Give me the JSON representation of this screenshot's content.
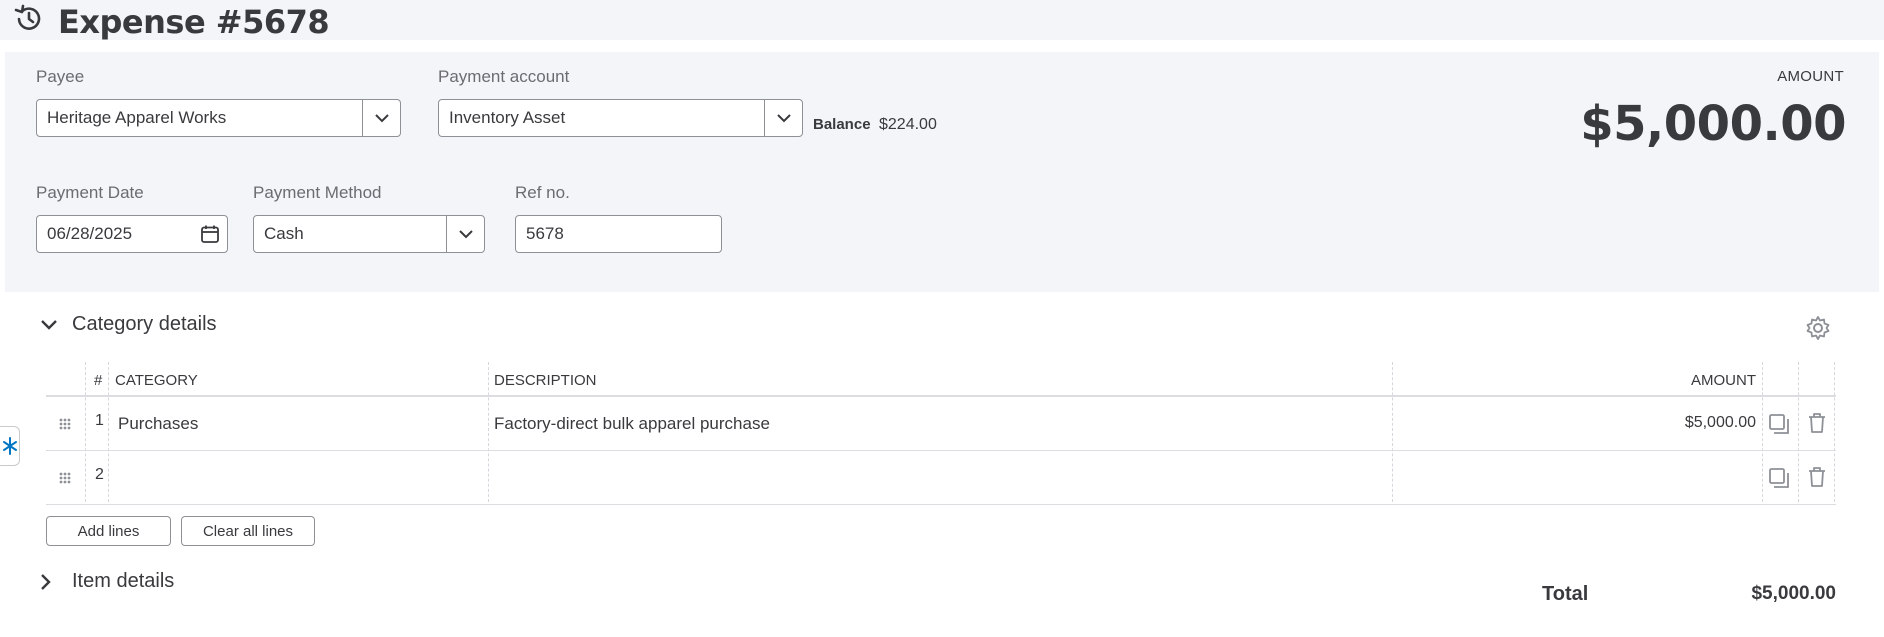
{
  "header": {
    "title": "Expense #5678",
    "history_icon": "history-icon"
  },
  "form": {
    "payee": {
      "label": "Payee",
      "value": "Heritage Apparel Works"
    },
    "payment_account": {
      "label": "Payment account",
      "value": "Inventory Asset"
    },
    "balance": {
      "label": "Balance",
      "value": "$224.00"
    },
    "amount": {
      "label": "AMOUNT",
      "value": "$5,000.00"
    },
    "payment_date": {
      "label": "Payment Date",
      "value": "06/28/2025"
    },
    "payment_method": {
      "label": "Payment Method",
      "value": "Cash"
    },
    "ref_no": {
      "label": "Ref no.",
      "value": "5678"
    }
  },
  "category_details": {
    "title": "Category details",
    "columns": {
      "num": "#",
      "category": "CATEGORY",
      "description": "DESCRIPTION",
      "amount": "AMOUNT"
    },
    "rows": [
      {
        "num": "1",
        "category": "Purchases",
        "description": "Factory-direct bulk apparel purchase",
        "amount": "$5,000.00"
      },
      {
        "num": "2",
        "category": "",
        "description": "",
        "amount": ""
      }
    ],
    "add_lines_label": "Add lines",
    "clear_lines_label": "Clear all lines"
  },
  "item_details": {
    "title": "Item details"
  },
  "totals": {
    "label": "Total",
    "value": "$5,000.00"
  },
  "colors": {
    "background_panel": "#f4f5f8",
    "text": "#393a3d",
    "border": "#8d9096",
    "accent": "#0077c5"
  }
}
